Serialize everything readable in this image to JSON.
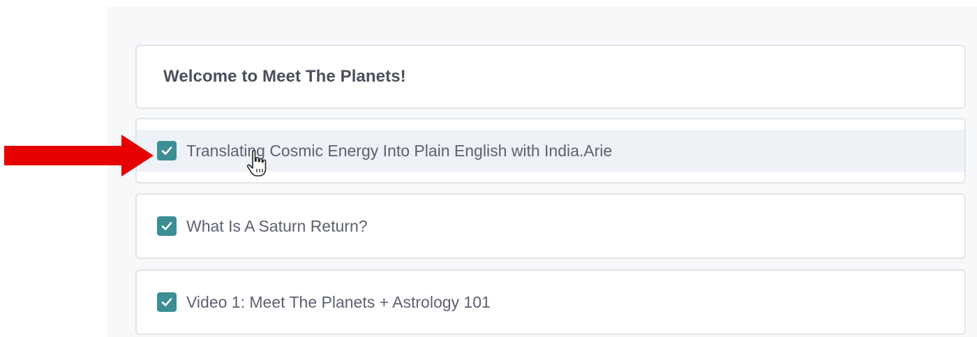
{
  "section": {
    "title": "Welcome to Meet The Planets!"
  },
  "lessons": [
    {
      "title": "Translating Cosmic Energy Into Plain English with India.Arie",
      "completed": true,
      "icon": "check-icon"
    },
    {
      "title": "What Is A Saturn Return?",
      "completed": true,
      "icon": "check-icon"
    },
    {
      "title": "Video 1: Meet The Planets + Astrology 101",
      "completed": true,
      "icon": "check-icon"
    }
  ],
  "colors": {
    "checkbox": "#3c8e95",
    "arrow": "#e60000",
    "title_text": "#4b4f5c",
    "lesson_text": "#5d6170",
    "card_border": "#e1e4e8",
    "panel_bg": "#f7f8fa",
    "hover_band": "#eef1f5"
  },
  "annotations": {
    "arrow_icon": "arrow-right-icon",
    "cursor_icon": "hand-pointer-icon"
  }
}
